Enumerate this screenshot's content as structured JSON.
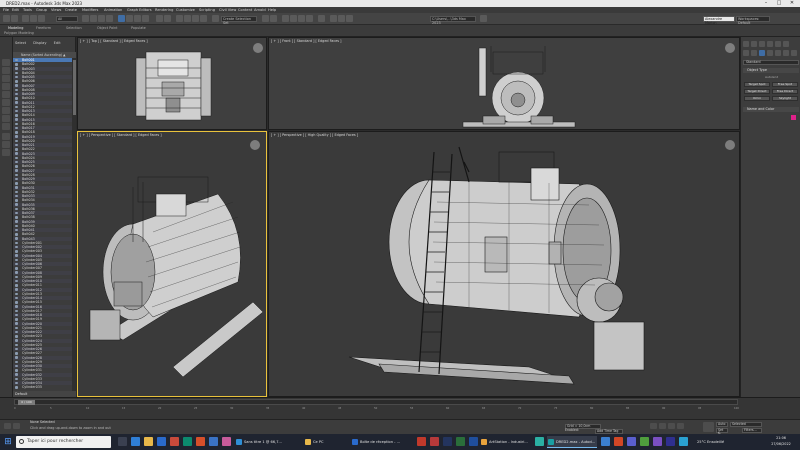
{
  "window": {
    "title": "DRED2.max - Autodesk 3ds Max 2023",
    "controls": [
      "–",
      "□",
      "✕"
    ]
  },
  "menu": [
    "File",
    "Edit",
    "Tools",
    "Group",
    "Views",
    "Create",
    "Modifiers",
    "Animation",
    "Graph Editors",
    "Rendering",
    "Customize",
    "Scripting",
    "Civil View",
    "Content",
    "Arnold",
    "Help"
  ],
  "toolbar": {
    "filter_value": "All",
    "selection_set": "Create Selection Set",
    "workspace": "Workspaces: Default",
    "account": "Alexandre Marion",
    "project_path": "C:\\Users\\...\\3ds Max 2023"
  },
  "ribbon": {
    "tabs": [
      "Modeling",
      "Freeform",
      "Selection",
      "Object Paint",
      "Populate"
    ],
    "active_tab": "Modeling",
    "label": "Polygon Modeling"
  },
  "scene_explorer": {
    "tabs": [
      "Select",
      "Display",
      "Edit"
    ],
    "column_header": "Name (Sorted Ascending)  ▲ Frozen",
    "items": [
      "Bolt001",
      "Bolt002",
      "Bolt003",
      "Bolt004",
      "Bolt005",
      "Bolt006",
      "Bolt007",
      "Bolt008",
      "Bolt009",
      "Bolt010",
      "Bolt011",
      "Bolt012",
      "Bolt013",
      "Bolt014",
      "Bolt015",
      "Bolt016",
      "Bolt017",
      "Bolt018",
      "Bolt019",
      "Bolt020",
      "Bolt021",
      "Bolt022",
      "Bolt023",
      "Bolt024",
      "Bolt025",
      "Bolt026",
      "Bolt027",
      "Bolt028",
      "Bolt029",
      "Bolt030",
      "Bolt031",
      "Bolt032",
      "Bolt033",
      "Bolt034",
      "Bolt035",
      "Bolt036",
      "Bolt037",
      "Bolt038",
      "Bolt039",
      "Bolt040",
      "Bolt041",
      "Bolt042",
      "Bolt043",
      "Cylinder001",
      "Cylinder002",
      "Cylinder003",
      "Cylinder004",
      "Cylinder005",
      "Cylinder006",
      "Cylinder007",
      "Cylinder008",
      "Cylinder009",
      "Cylinder010",
      "Cylinder011",
      "Cylinder012",
      "Cylinder013",
      "Cylinder014",
      "Cylinder015",
      "Cylinder016",
      "Cylinder017",
      "Cylinder018",
      "Cylinder019",
      "Cylinder020",
      "Cylinder021",
      "Cylinder022",
      "Cylinder023",
      "Cylinder024",
      "Cylinder025",
      "Cylinder026",
      "Cylinder027",
      "Cylinder028",
      "Cylinder029",
      "Cylinder030",
      "Cylinder031",
      "Cylinder032",
      "Cylinder033",
      "Cylinder034",
      "Cylinder035"
    ],
    "selected_index": 0,
    "layer": "Default"
  },
  "viewports": {
    "top": "[ + ] [ Top ] [ Standard ] [ Edged Faces ]",
    "front": "[ + ] [ Front ] [ Standard ] [ Edged Faces ]",
    "persp1": "[ + ] [ Perspective ] [ Standard ] [ Edged Faces ]",
    "persp2": "[ + ] [ Perspective ] [ High Quality ] [ Edged Faces ]"
  },
  "command_panel": {
    "dropdown": "Standard",
    "object_type": "Object Type",
    "autogrid": "AutoGrid",
    "buttons": [
      "Target Spot",
      "Free Spot",
      "Target Direct",
      "Free Direct",
      "Omni",
      "Skylight"
    ],
    "name_and_color": "Name and Color",
    "swatch_color": "#e0218a"
  },
  "timeline": {
    "frame_indicator": "0 / 100",
    "ticks": [
      "0",
      "5",
      "10",
      "15",
      "20",
      "25",
      "30",
      "35",
      "40",
      "45",
      "50",
      "55",
      "60",
      "65",
      "70",
      "75",
      "80",
      "85",
      "90",
      "95",
      "100"
    ]
  },
  "status": {
    "line1": "None Selected",
    "line2": "Click and drag up-and-down to zoom in and out",
    "grid": "Grid = 10,0cm",
    "auto": "Auto",
    "set_key": "Set K.",
    "selected": "Selected",
    "filters": "Filters...",
    "enabled": "Enabled:",
    "add_time_tag": "Add Time Tag"
  },
  "taskbar": {
    "search_placeholder": "Taper ici pour rechercher",
    "tasks": [
      "Sans titre 1 @ 66,7...",
      "Ce PC",
      "Boîte de réception - ...",
      "ArtStation - Industri...",
      "DRED2.max - Autod..."
    ],
    "weather": "25°C  Ensoleillé",
    "time": "21:06",
    "date": "27/06/2022"
  },
  "colors": {
    "accent": "#e9c23c",
    "selection": "#4a78b4",
    "taskbar": "#1f2430"
  }
}
